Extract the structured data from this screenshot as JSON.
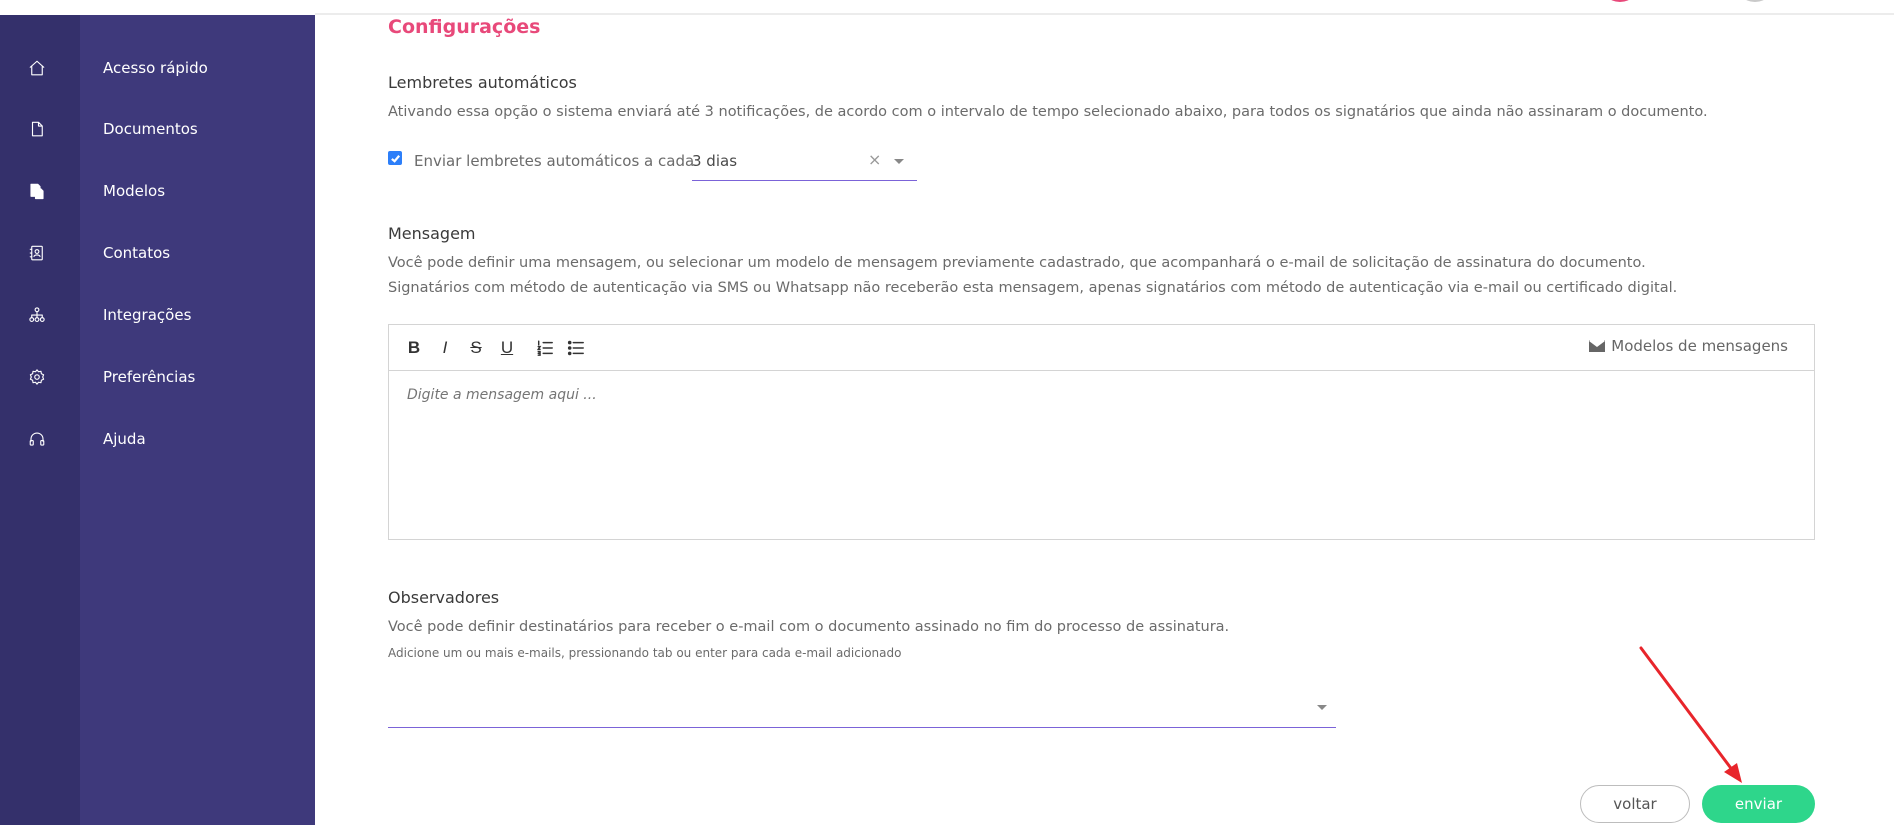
{
  "sidebar": {
    "items": [
      {
        "label": "Acesso rápido",
        "icon": "home-icon"
      },
      {
        "label": "Documentos",
        "icon": "document-icon"
      },
      {
        "label": "Modelos",
        "icon": "templates-icon"
      },
      {
        "label": "Contatos",
        "icon": "contacts-icon"
      },
      {
        "label": "Integrações",
        "icon": "integrations-icon"
      },
      {
        "label": "Preferências",
        "icon": "gear-icon"
      },
      {
        "label": "Ajuda",
        "icon": "headset-icon"
      }
    ],
    "colors": {
      "rail": "#34306b",
      "panel": "#3e397b"
    }
  },
  "page": {
    "title": "Configurações",
    "accent_color": "#e8497a"
  },
  "reminders": {
    "title": "Lembretes automáticos",
    "description": "Ativando essa opção o sistema enviará até 3 notificações, de acordo com o intervalo de tempo selecionado abaixo, para todos os signatários que ainda não assinaram o documento.",
    "checkbox_label": "Enviar lembretes automáticos a cada",
    "checked": true,
    "interval_value": "3 dias",
    "clear_symbol": "×"
  },
  "message": {
    "title": "Mensagem",
    "description_line1": "Você pode definir uma mensagem, ou selecionar um modelo de mensagem previamente cadastrado, que acompanhará o e-mail de solicitação de assinatura do documento.",
    "description_line2": "Signatários com método de autenticação via SMS ou Whatsapp não receberão esta mensagem, apenas signatários com método de autenticação via e-mail ou certificado digital.",
    "toolbar": {
      "bold": "B",
      "italic": "I",
      "strike": "S",
      "underline": "U",
      "templates_label": "Modelos de mensagens"
    },
    "placeholder": "Digite a mensagem aqui ..."
  },
  "observers": {
    "title": "Observadores",
    "description": "Você pode definir destinatários para receber o e-mail com o documento assinado no fim do processo de assinatura.",
    "hint": "Adicione um ou mais e-mails, pressionando tab ou enter para cada e-mail adicionado"
  },
  "actions": {
    "back_label": "voltar",
    "send_label": "enviar",
    "send_color": "#2ed68b"
  }
}
